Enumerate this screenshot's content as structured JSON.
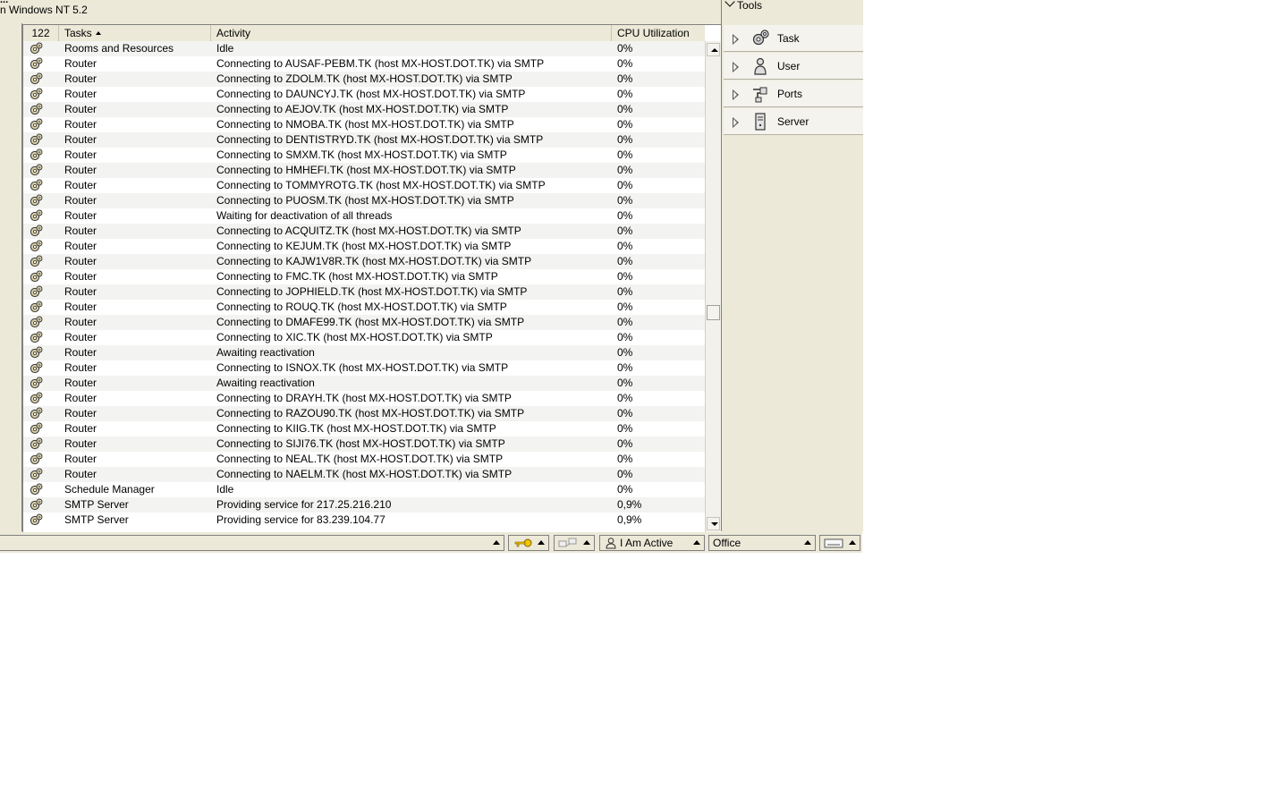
{
  "window": {
    "title_fragment": "...",
    "os_text": "n Windows NT 5.2"
  },
  "grid": {
    "row_count": "122",
    "columns": {
      "tasks": "Tasks",
      "activity": "Activity",
      "cpu": "CPU Utilization"
    },
    "rows": [
      {
        "task": "Rooms and Resources",
        "activity": "Idle",
        "cpu": "0%"
      },
      {
        "task": "Router",
        "activity": "Connecting to AUSAF-PEBM.TK (host MX-HOST.DOT.TK) via SMTP",
        "cpu": "0%"
      },
      {
        "task": "Router",
        "activity": "Connecting to ZDOLM.TK (host MX-HOST.DOT.TK) via SMTP",
        "cpu": "0%"
      },
      {
        "task": "Router",
        "activity": "Connecting to DAUNCYJ.TK (host MX-HOST.DOT.TK) via SMTP",
        "cpu": "0%"
      },
      {
        "task": "Router",
        "activity": "Connecting to AEJOV.TK (host MX-HOST.DOT.TK) via SMTP",
        "cpu": "0%"
      },
      {
        "task": "Router",
        "activity": "Connecting to NMOBA.TK (host MX-HOST.DOT.TK) via SMTP",
        "cpu": "0%"
      },
      {
        "task": "Router",
        "activity": "Connecting to DENTISTRYD.TK (host MX-HOST.DOT.TK) via SMTP",
        "cpu": "0%"
      },
      {
        "task": "Router",
        "activity": "Connecting to SMXM.TK (host MX-HOST.DOT.TK) via SMTP",
        "cpu": "0%"
      },
      {
        "task": "Router",
        "activity": "Connecting to HMHEFI.TK (host MX-HOST.DOT.TK) via SMTP",
        "cpu": "0%"
      },
      {
        "task": "Router",
        "activity": "Connecting to TOMMYROTG.TK (host MX-HOST.DOT.TK) via SMTP",
        "cpu": "0%"
      },
      {
        "task": "Router",
        "activity": "Connecting to PUOSM.TK (host MX-HOST.DOT.TK) via SMTP",
        "cpu": "0%"
      },
      {
        "task": "Router",
        "activity": "Waiting for deactivation of all threads",
        "cpu": "0%"
      },
      {
        "task": "Router",
        "activity": "Connecting to ACQUITZ.TK (host MX-HOST.DOT.TK) via SMTP",
        "cpu": "0%"
      },
      {
        "task": "Router",
        "activity": "Connecting to KEJUM.TK (host MX-HOST.DOT.TK) via SMTP",
        "cpu": "0%"
      },
      {
        "task": "Router",
        "activity": "Connecting to KAJW1V8R.TK (host MX-HOST.DOT.TK) via SMTP",
        "cpu": "0%"
      },
      {
        "task": "Router",
        "activity": "Connecting to FMC.TK (host MX-HOST.DOT.TK) via SMTP",
        "cpu": "0%"
      },
      {
        "task": "Router",
        "activity": "Connecting to JOPHIELD.TK (host MX-HOST.DOT.TK) via SMTP",
        "cpu": "0%"
      },
      {
        "task": "Router",
        "activity": "Connecting to ROUQ.TK (host MX-HOST.DOT.TK) via SMTP",
        "cpu": "0%"
      },
      {
        "task": "Router",
        "activity": "Connecting to DMAFE99.TK (host MX-HOST.DOT.TK) via SMTP",
        "cpu": "0%"
      },
      {
        "task": "Router",
        "activity": "Connecting to XIC.TK (host MX-HOST.DOT.TK) via SMTP",
        "cpu": "0%"
      },
      {
        "task": "Router",
        "activity": "Awaiting reactivation",
        "cpu": "0%"
      },
      {
        "task": "Router",
        "activity": "Connecting to ISNOX.TK (host MX-HOST.DOT.TK) via SMTP",
        "cpu": "0%"
      },
      {
        "task": "Router",
        "activity": "Awaiting reactivation",
        "cpu": "0%"
      },
      {
        "task": "Router",
        "activity": "Connecting to DRAYH.TK (host MX-HOST.DOT.TK) via SMTP",
        "cpu": "0%"
      },
      {
        "task": "Router",
        "activity": "Connecting to RAZOU90.TK (host MX-HOST.DOT.TK) via SMTP",
        "cpu": "0%"
      },
      {
        "task": "Router",
        "activity": "Connecting to KIIG.TK (host MX-HOST.DOT.TK) via SMTP",
        "cpu": "0%"
      },
      {
        "task": "Router",
        "activity": "Connecting to SIJI76.TK (host MX-HOST.DOT.TK) via SMTP",
        "cpu": "0%"
      },
      {
        "task": "Router",
        "activity": "Connecting to NEAL.TK (host MX-HOST.DOT.TK) via SMTP",
        "cpu": "0%"
      },
      {
        "task": "Router",
        "activity": "Connecting to NAELM.TK (host MX-HOST.DOT.TK) via SMTP",
        "cpu": "0%"
      },
      {
        "task": "Schedule Manager",
        "activity": "Idle",
        "cpu": "0%"
      },
      {
        "task": "SMTP Server",
        "activity": "Providing service for 217.25.216.210",
        "cpu": "0,9%"
      },
      {
        "task": "SMTP Server",
        "activity": "Providing service for 83.239.104.77",
        "cpu": "0,9%"
      }
    ]
  },
  "tools": {
    "title": "Tools",
    "items": [
      {
        "label": "Task",
        "icon": "gears-icon"
      },
      {
        "label": "User",
        "icon": "user-icon"
      },
      {
        "label": "Ports",
        "icon": "ports-icon"
      },
      {
        "label": "Server",
        "icon": "server-icon"
      }
    ]
  },
  "statusbar": {
    "location": "I Am Active",
    "place": "Office"
  },
  "colors": {
    "chrome": "#ece9d8",
    "row_alt": "#f3f3f1",
    "border": "#808080"
  }
}
